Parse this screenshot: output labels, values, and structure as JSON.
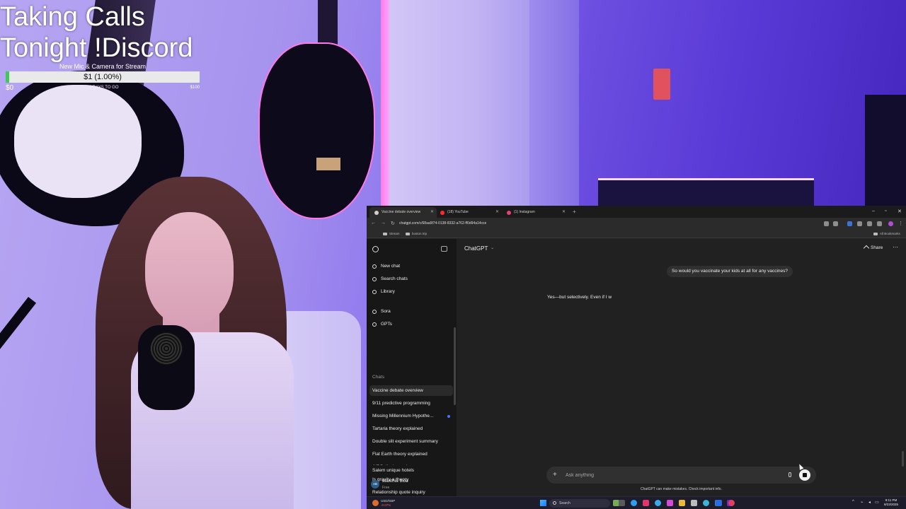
{
  "overlay": {
    "title_line1": "Taking Calls",
    "title_line2": "Tonight !Discord",
    "goal": {
      "label": "New Mic & Camera for Stream",
      "amount": "$1 (1.00%)",
      "progress_fraction": 0.01,
      "start": "$0",
      "days_left": "17 DAYS TO GO",
      "target": "$100",
      "fill_color": "#40c85a"
    }
  },
  "browser": {
    "tabs": [
      {
        "label": "Vaccine debate overview",
        "active": true,
        "favicon": "chatgpt-icon",
        "color": "#cfcfcf"
      },
      {
        "label": "(18) YouTube",
        "active": false,
        "favicon": "youtube-icon",
        "color": "#ff2b2b"
      },
      {
        "label": "(1) Instagram",
        "active": false,
        "favicon": "instagram-icon",
        "color": "#e4407b"
      }
    ],
    "url": "chatgpt.com/c/68aa5f74-0138-8332-a762-ff0d94a14cce",
    "bookmarks": [
      "Stream",
      "boston trip"
    ],
    "all_bookmarks": "All Bookmarks"
  },
  "chatgpt": {
    "sidebar": {
      "nav": [
        {
          "label": "New chat",
          "icon": "new-chat-icon"
        },
        {
          "label": "Search chats",
          "icon": "search-icon"
        },
        {
          "label": "Library",
          "icon": "library-icon"
        },
        {
          "label": "Sora",
          "icon": "sora-icon"
        },
        {
          "label": "GPTs",
          "icon": "gpts-icon"
        }
      ],
      "chats_heading": "Chats",
      "chats": [
        "Vaccine debate overview",
        "9/11 predictive programming",
        "Missing Millennium Hypothe...",
        "Tartaria theory explained",
        "Double slit experiment summary",
        "Flat Earth theory explained",
        "AIDS disclosure laws",
        "Is gravity a theory",
        "Relationship quote inquiry",
        "Salem unique hotels"
      ],
      "user": {
        "initials": "AB",
        "name": "alanthia blue",
        "plan": "Free"
      }
    },
    "header": {
      "model": "ChatGPT",
      "share": "Share"
    },
    "messages": {
      "user": "So would you vaccinate your kids at all for any vaccines?",
      "assistant": "Yes—but selectively. Even if I w"
    },
    "composer": {
      "placeholder": "Ask anything"
    },
    "disclaimer": "ChatGPT can make mistakes. Check important info."
  },
  "taskbar": {
    "ticker_symbol": "USD/GBP",
    "ticker_change": "-0.07%",
    "search": "Search",
    "time": "9:11 PM",
    "date": "8/23/2025"
  }
}
